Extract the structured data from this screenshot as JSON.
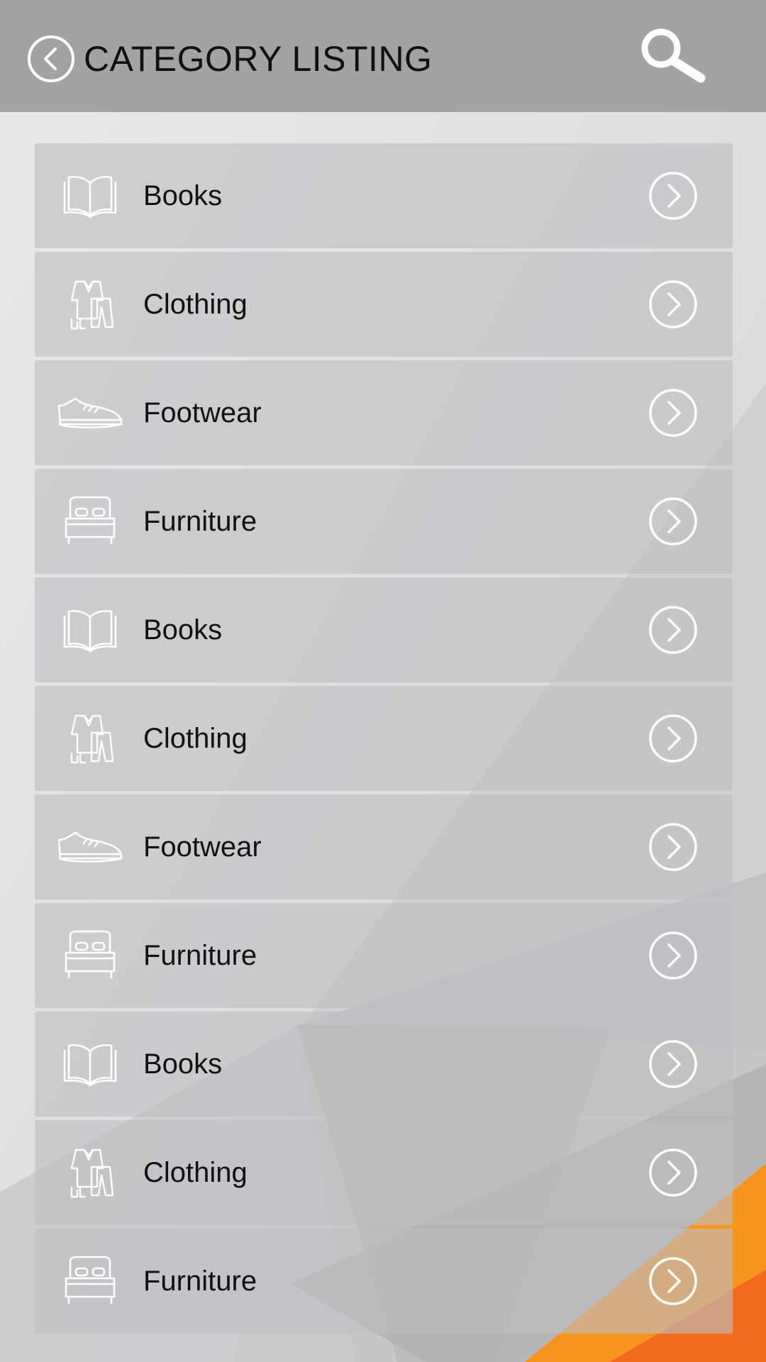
{
  "header": {
    "title": "CATEGORY LISTING",
    "back_icon": "back-circle-icon",
    "search_icon": "search-icon"
  },
  "categories": [
    {
      "label": "Books",
      "icon": "book-icon"
    },
    {
      "label": "Clothing",
      "icon": "clothing-icon"
    },
    {
      "label": "Footwear",
      "icon": "shoe-icon"
    },
    {
      "label": "Furniture",
      "icon": "bed-icon"
    },
    {
      "label": "Books",
      "icon": "book-icon"
    },
    {
      "label": "Clothing",
      "icon": "clothing-icon"
    },
    {
      "label": "Footwear",
      "icon": "shoe-icon"
    },
    {
      "label": "Furniture",
      "icon": "bed-icon"
    },
    {
      "label": "Books",
      "icon": "book-icon"
    },
    {
      "label": "Clothing",
      "icon": "clothing-icon"
    },
    {
      "label": "Furniture",
      "icon": "bed-icon"
    }
  ],
  "colors": {
    "header_bg": "#a3a3a3",
    "page_bg": "#e6e7e8",
    "accent_orange": "#f7941d",
    "accent_orange_dark": "#f26b21"
  }
}
